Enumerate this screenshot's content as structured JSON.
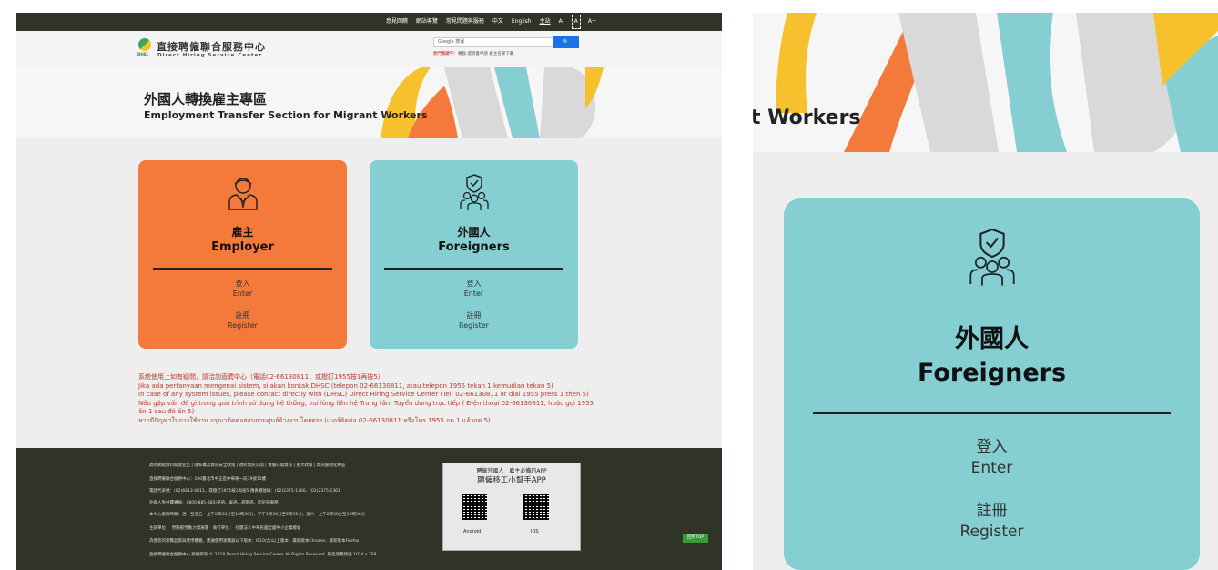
{
  "topbar": {
    "items": [
      "意見回饋",
      "網站導覽",
      "常見問題與服務",
      "中文",
      "English",
      "主站",
      "A-",
      "A",
      "A+"
    ]
  },
  "header": {
    "logo_title": "直接聘僱聯合服務中心",
    "logo_subtitle": "Direct Hiring Service Center",
    "logo_abbr": "DHSC",
    "search_placeholder": "Google 搜尋",
    "search_button": "🔍",
    "hot_label": "熱門關鍵字：",
    "hot_links": "轉換 證明書申請 雇主名單下載"
  },
  "hero": {
    "title_zh": "外國人轉換雇主專區",
    "title_en": "Employment Transfer Section for Migrant Workers",
    "title_en_crop": "t Workers"
  },
  "cards": {
    "employer": {
      "zh": "雇主",
      "en": "Employer",
      "login_zh": "登入",
      "login_en": "Enter",
      "register_zh": "註冊",
      "register_en": "Register",
      "color": "#f47a3b"
    },
    "foreigner": {
      "zh": "外國人",
      "en": "Foreigners",
      "login_zh": "登入",
      "login_en": "Enter",
      "register_zh": "註冊",
      "register_en": "Register",
      "color": "#85cfd2"
    }
  },
  "notice": {
    "line1": "系統使用上如有疑問，請洽詢直聘中心（電話02-66130811，或撥打1955按1再按5）",
    "line2": "Jika ada pertanyaan mengenai sistem, silakan kontak DHSC (telepon 02-66130811, atau telepon 1955 tekan 1 kemudian tekan 5)",
    "line3": "In case of any system issues, please contact directly with (DHSC) Direct Hiring Service Center (Tel: 02-66130811 or dial 1955 press 1 then 5)",
    "line4": "Nếu gặp vấn đề gì trong quá trình sử dụng hệ thống, vui lòng liên hệ Trung tâm Tuyển dụng trực tiếp ( Điện thoại 02-66130811, hoặc gọi 1955 ấn 1 sau đó ấn 5)",
    "line5": "หากมีปัญหาในการใช้งาน กรุณาติดต่อสอบถามศูนย์จ้างงานโดยตรง (เบอร์ติดต่อ 02-66130811 หรือโทร 1955 กด 1 แล้วกด 5)"
  },
  "footer": {
    "links": "政府網站資料開放宣告 | 隱私權及資訊安全政策 | 政府資訊公開 | 實價公開資訊 | 重大政策 | 資訊服務化專區",
    "address": "直接聘僱聯合服務中心：100臺北市中正區中華路一段39號15樓",
    "phone": "電話代表號：(02)6613-0811，或撥打1955按1再按5 傳真機號碼：(02)2375-1360、(02)2375-1361",
    "hotline": "外國人免付費專線：0800-885-885(英語、泰語、越南語、印尼語服務)",
    "hours": "本中心服務時間：週一至週五　上午8時30分至12時30分，下午1時30分至5時30分；週六　上午8時30分至12時30分",
    "host": "主辦單位：　勞動部勞動力發展署　執行單位：　社團法人中華民國全國中小企業總會",
    "browser": "為使您的瀏覽品質與使用體驗，建議使用瀏覽器以下版本：IE10(含)以上版本、最新版本Chrome、最新版本Firefox",
    "copyright": "直接聘僱聯合服務中心 版權所有 © 2018 Direct Hiring Service Center All Rights Reserved. 最佳瀏覽建議 1024 x 768",
    "app_line1": "聘僱外國人　雇主必備的APP",
    "app_line2": "聘僱移工小幫手APP",
    "android": "Android",
    "ios": "IOS",
    "top_button": "回到TOP"
  }
}
